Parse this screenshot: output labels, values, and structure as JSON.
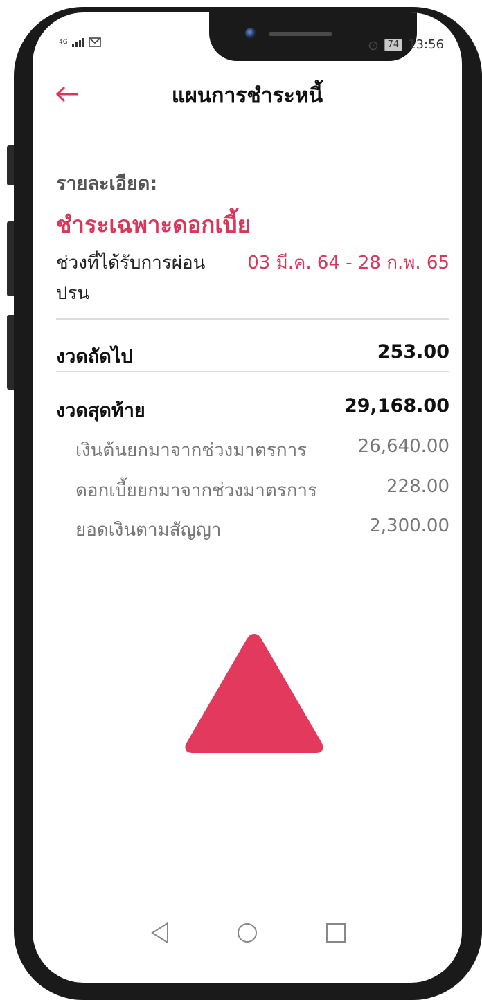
{
  "status_bar": {
    "network": "4G",
    "battery": "74",
    "time": "13:56"
  },
  "header": {
    "title": "แผนการชำระหนี้"
  },
  "details": {
    "label": "รายละเอียด:",
    "plan_name": "ชำระเฉพาะดอกเบี้ย",
    "relief_period_label": "ช่วงที่ได้รับการผ่อนปรน",
    "relief_period_value": "03 มี.ค. 64 - 28 ก.พ. 65"
  },
  "next_installment": {
    "label": "งวดถัดไป",
    "value": "253.00"
  },
  "final_installment": {
    "label": "งวดสุดท้าย",
    "value": "29,168.00",
    "breakdown": [
      {
        "label": "เงินต้นยกมาจากช่วงมาตรการ",
        "value": "26,640.00"
      },
      {
        "label": "ดอกเบี้ยยกมาจากช่วงมาตรการ",
        "value": "228.00"
      },
      {
        "label": "ยอดเงินตามสัญญา",
        "value": "2,300.00"
      }
    ]
  },
  "icons": {
    "back": "arrow-left-icon",
    "warning": "triangle-icon",
    "nav_back": "nav-back-icon",
    "nav_home": "nav-home-icon",
    "nav_recents": "nav-recents-icon"
  },
  "colors": {
    "accent": "#d9375a",
    "triangle": "#e2395c",
    "frame": "#1a1a1a"
  }
}
